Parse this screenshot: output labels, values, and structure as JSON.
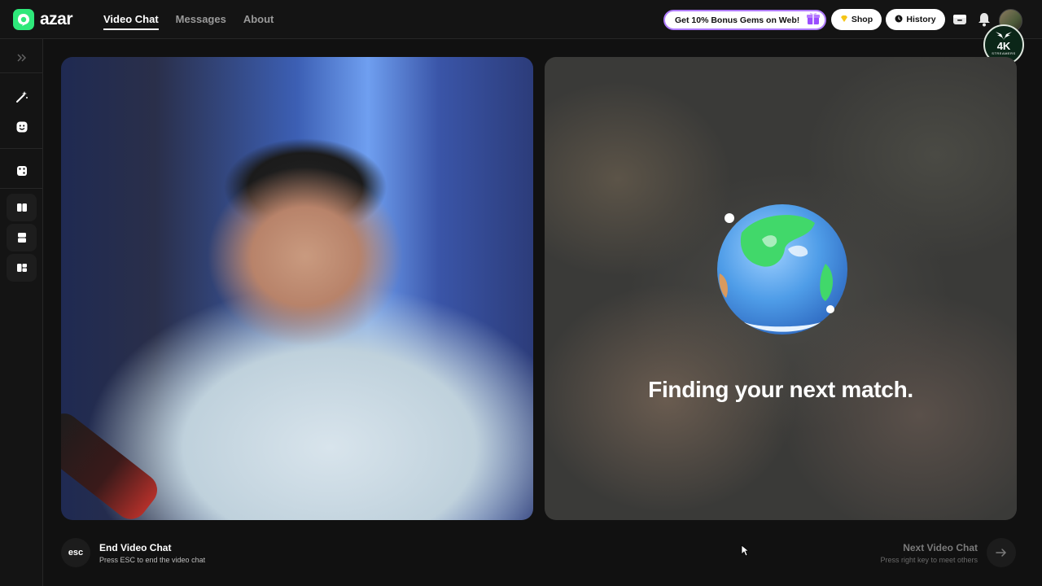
{
  "brand": {
    "name": "azar",
    "accent": "#2ee87a"
  },
  "nav": {
    "items": [
      {
        "label": "Video Chat",
        "active": true
      },
      {
        "label": "Messages",
        "active": false
      },
      {
        "label": "About",
        "active": false
      }
    ]
  },
  "header": {
    "promo_text": "Get 10% Bonus Gems on Web!",
    "shop_label": "Shop",
    "history_label": "History",
    "badge_title": "4K",
    "badge_sub": "STREAMERS"
  },
  "sidebar": {
    "icons": [
      "expand-chevrons-icon",
      "magic-wand-icon",
      "face-sticker-icon",
      "dice-icon",
      "layout-side-by-side-icon",
      "layout-stacked-icon",
      "layout-grid-icon"
    ]
  },
  "match": {
    "status_text": "Finding your next match."
  },
  "controls": {
    "esc_key": "esc",
    "end_title": "End Video Chat",
    "end_sub": "Press ESC to end the video chat",
    "next_title": "Next Video Chat",
    "next_sub": "Press right key to meet others"
  },
  "colors": {
    "background": "#111111",
    "promo_border": "#b07cff",
    "globe_ocean": "#4f9de8",
    "globe_land": "#41d86a"
  }
}
